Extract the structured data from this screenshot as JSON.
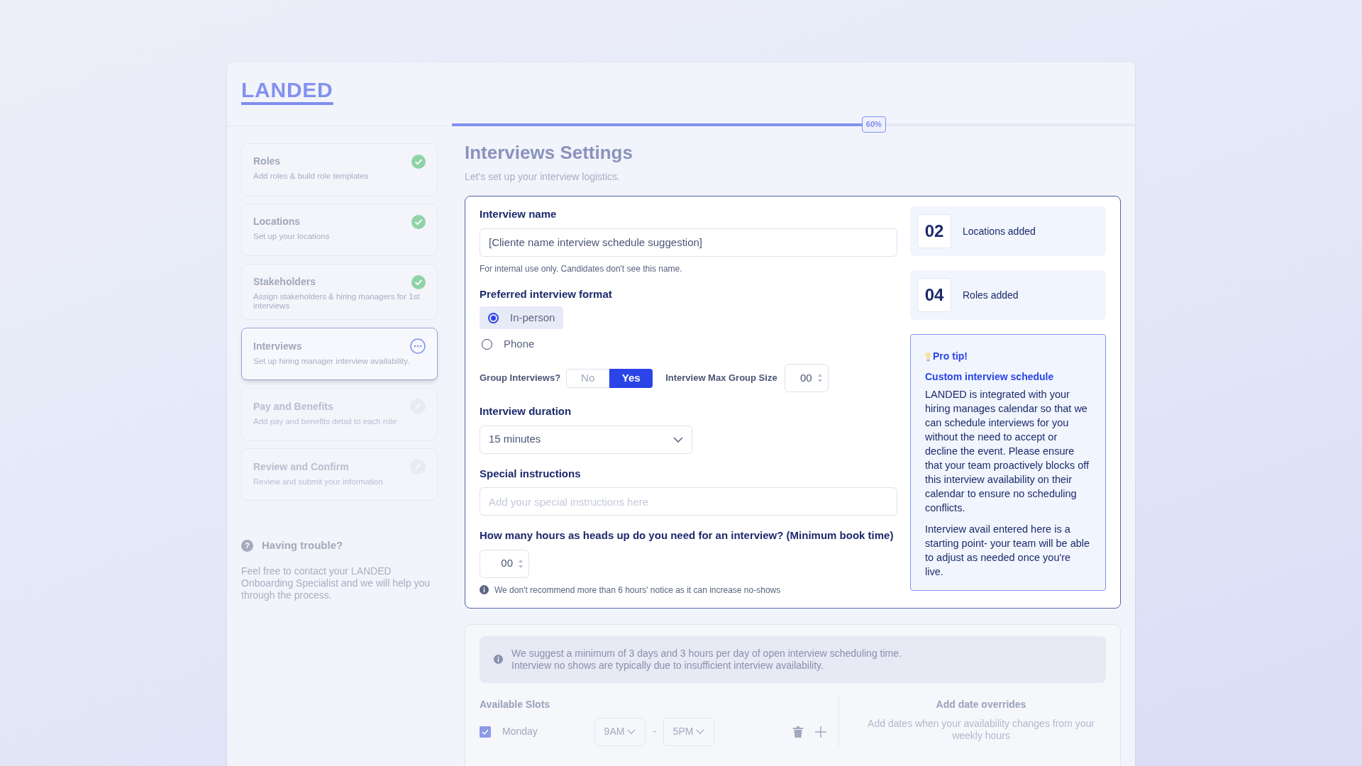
{
  "logo": "LANDED",
  "steps": [
    {
      "title": "Roles",
      "description": "Add roles & build role templates",
      "kind": "done",
      "selected": false
    },
    {
      "title": "Locations",
      "description": "Set up your locations",
      "kind": "done",
      "selected": false
    },
    {
      "title": "Stakeholders",
      "description": "Assign stakeholders & hiring managers for 1st interviews",
      "kind": "done",
      "selected": false
    },
    {
      "title": "Interviews",
      "description": "Set up hiring manager interview availability.",
      "kind": "current",
      "selected": true
    },
    {
      "title": "Pay and Benefits",
      "description": "Add pay and benefits detail to each role",
      "kind": "pending",
      "selected": false
    },
    {
      "title": "Review and Confirm",
      "description": "Review and submit your information",
      "kind": "pending",
      "selected": false
    }
  ],
  "help": {
    "icon": "?",
    "title": "Having trouble?",
    "text": "Feel free to contact your LANDED Onboarding Specialist and we will help you through the process."
  },
  "progress": {
    "level": 0.6,
    "label": "60%"
  },
  "page": {
    "title": "Interviews Settings",
    "subtitle": "Let's set up your interview logistics."
  },
  "form": {
    "name_label": "Interview name",
    "name_value": "[Cliente name interview schedule suggestion]",
    "name_hint": "For internal use only. Candidates don't see this name.",
    "format_label": "Preferred interview format",
    "formats": [
      {
        "label": "In-person",
        "selected": true
      },
      {
        "label": "Phone",
        "selected": false
      }
    ],
    "group_label": "Group Interviews?",
    "group_options": [
      {
        "label": "No",
        "selected": false
      },
      {
        "label": "Yes",
        "selected": true
      }
    ],
    "group_size_label": "Interview Max Group Size",
    "group_size_value": "00",
    "duration_label": "Interview duration",
    "duration_value": "15 minutes",
    "instructions_label": "Special instructions",
    "instructions_placeholder": "Add your special instructions here",
    "heads_up_label": "How many hours as heads up do you need for an interview? (Minimum book time)",
    "heads_up_value": "00",
    "heads_up_note": "We don't recommend more than 6 hours' notice as it can increase no-shows"
  },
  "stats": [
    {
      "number": "02",
      "label": "Locations added"
    },
    {
      "number": "04",
      "label": "Roles added"
    }
  ],
  "tip": {
    "badge": "Pro tip!",
    "title": "Custom interview schedule",
    "paragraphs": [
      "LANDED is integrated with your hiring manages calendar so that we can schedule interviews for you without the need to accept or decline the event. Please ensure that your team proactively blocks off this interview availability on their calendar to ensure no scheduling conflicts.",
      "Interview avail entered here is a starting point- your team will be able to adjust as needed once you're live."
    ]
  },
  "availability": {
    "notice": [
      "We suggest a minimum of 3 days and 3 hours per day of open interview scheduling time.",
      "Interview no shows are typically due to insufficient interview availability."
    ],
    "slots_title": "Available Slots",
    "days": [
      {
        "day": "Monday",
        "checked": true,
        "start": "9AM",
        "separator": "-",
        "end": "5PM"
      }
    ],
    "overrides_title": "Add date overrides",
    "overrides_text": "Add dates when your availability changes from your weekly hours"
  }
}
